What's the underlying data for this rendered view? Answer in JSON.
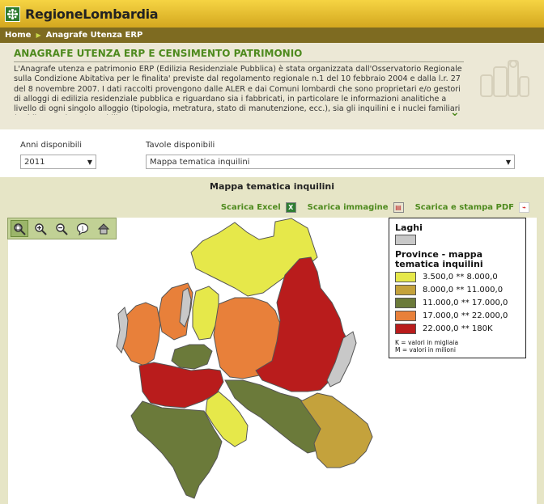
{
  "header": {
    "brand_prefix": "Regione",
    "brand_suffix": "Lombardia"
  },
  "breadcrumb": {
    "home": "Home",
    "current": "Anagrafe Utenza ERP"
  },
  "intro": {
    "title": "ANAGRAFE UTENZA ERP E CENSIMENTO PATRIMONIO",
    "text": "L'Anagrafe utenza e patrimonio ERP (Edilizia Residenziale Pubblica) è stata organizzata dall'Osservatorio Regionale sulla Condizione Abitativa per le finalita' previste dal regolamento regionale n.1 del 10 febbraio 2004 e dalla l.r. 27 del 8 novembre 2007. I dati raccolti provengono dalle ALER e dai Comuni lombardi che sono proprietari e/o gestori di alloggi di edilizia residenziale pubblica e riguardano sia i fabbricati, in particolare le informazioni analitiche a livello di ogni singolo alloggio (tipologia, metratura, stato di manutenzione, ecc.), sia gli inquilini e i nuclei familiari (reddito, patrimonio mobiliare e"
  },
  "filters": {
    "anni_label": "Anni disponibili",
    "anni_value": "2011",
    "tavole_label": "Tavole disponibili",
    "tavole_value": "Mappa tematica inquilini"
  },
  "map_section": {
    "title": "Mappa tematica inquilini",
    "download_excel": "Scarica Excel",
    "download_image": "Scarica immagine",
    "download_pdf": "Scarica e stampa PDF"
  },
  "toolbar": {
    "icons": [
      "zoom-box-icon",
      "zoom-in-icon",
      "zoom-out-icon",
      "info-icon",
      "home-icon"
    ]
  },
  "legend": {
    "lakes_title": "Laghi",
    "lakes_color": "#c8c8c8",
    "provinces_title": "Province - mappa tematica inquilini",
    "classes": [
      {
        "label": "3.500,0 ** 8.000,0",
        "color": "#e6e84a"
      },
      {
        "label": "8.000,0 ** 11.000,0",
        "color": "#c4a23c"
      },
      {
        "label": "11.000,0 ** 17.000,0",
        "color": "#6b7a3a"
      },
      {
        "label": "17.000,0 ** 22.000,0",
        "color": "#e8803a"
      },
      {
        "label": "22.000,0 ** 180K",
        "color": "#b91c1c"
      }
    ],
    "note_k": "K = valori in migliaia",
    "note_m": "M = valori in milioni"
  }
}
